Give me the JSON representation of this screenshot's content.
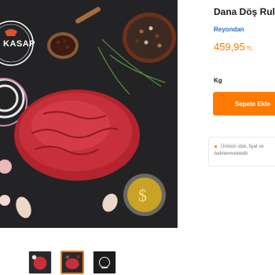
{
  "product": {
    "title": "Dana Döş Rulo",
    "brand": "Reyondan",
    "price": "459,95",
    "currency": "TL",
    "unit": "Kg",
    "add_to_cart_label": "Sepete Ekle"
  },
  "logo": {
    "text": "KASAP"
  },
  "stock_notice": {
    "line1": "Ürünün stok, fiyat ve",
    "line2": "belirlenmektedir."
  },
  "thumbnails": [
    {
      "name": "thumbnail-1",
      "active": false
    },
    {
      "name": "thumbnail-2",
      "active": true
    },
    {
      "name": "thumbnail-3",
      "active": false
    }
  ],
  "colors": {
    "accent": "#ff7a00",
    "brand_link": "#2b6cc4",
    "image_background": "#1f1f22"
  }
}
